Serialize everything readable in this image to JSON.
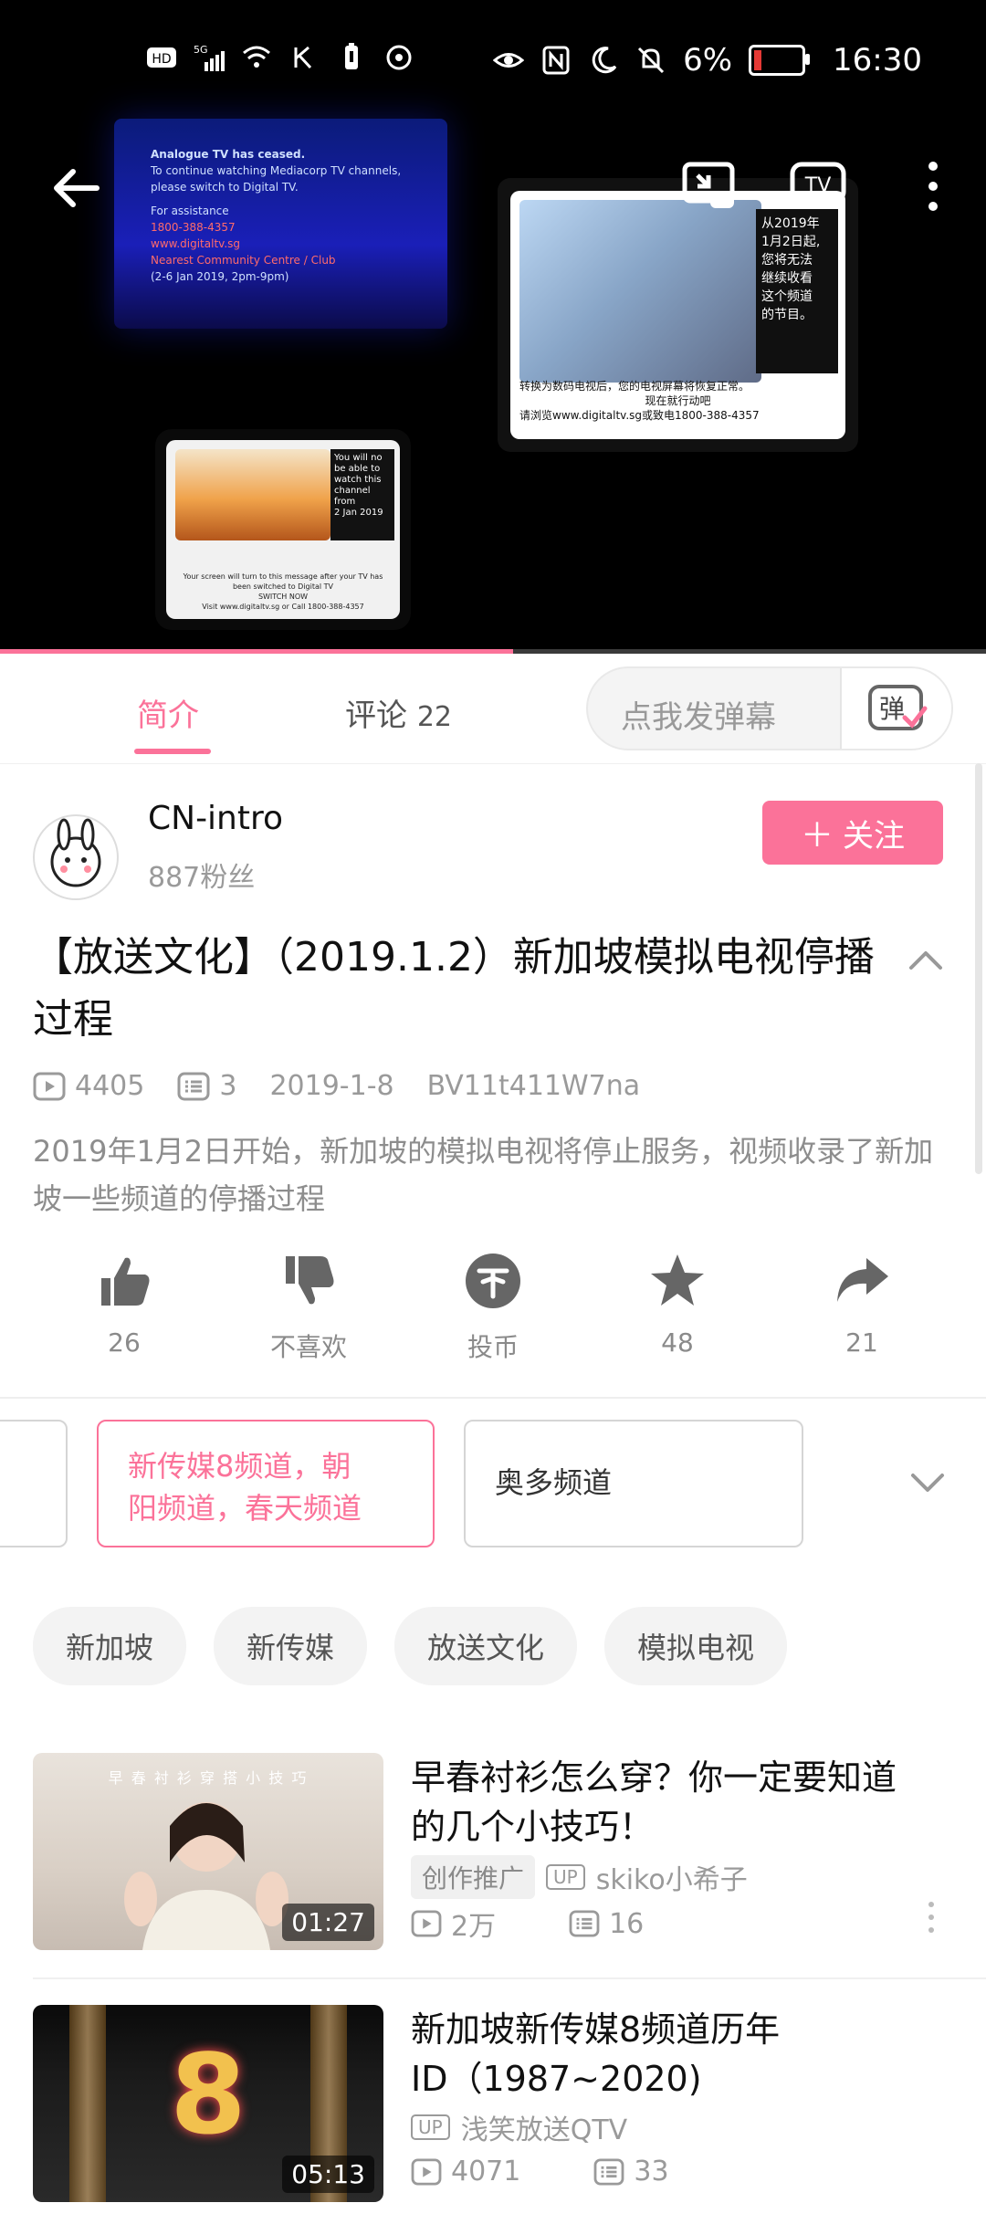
{
  "status_bar": {
    "left_icons": [
      "hd-icon",
      "signal-5g-icon",
      "wifi-icon",
      "k-icon",
      "battery-saver-icon",
      "hotspot-icon"
    ],
    "right_icons": [
      "eye-icon",
      "nfc-icon",
      "moon-icon",
      "mute-icon"
    ],
    "battery_percent": "6%",
    "time": "16:30"
  },
  "video": {
    "progress": 0.52,
    "tv_blue_text": [
      "Analogue TV has ceased.",
      "To continue watching Mediacorp TV channels,",
      "please switch to Digital TV.",
      "For assistance",
      "1800-388-4357",
      "www.digitaltv.sg",
      "Nearest Community Centre / Club",
      "(2-6 Jan 2019, 2pm-9pm)"
    ],
    "tv_left_side": [
      "You will no",
      "be able to",
      "watch this",
      "channel",
      "from",
      "2 Jan 2019"
    ],
    "tv_left_bottom": [
      "Your screen will turn to this message after your TV has been switched to Digital TV",
      "SWITCH NOW",
      "Visit www.digitaltv.sg or Call 1800-388-4357"
    ],
    "tv_right_side": [
      "从2019年",
      "1月2日起,",
      "您将无法",
      "继续收看",
      "这个频道",
      "的节目。"
    ],
    "tv_right_bottom": [
      "转换为数码电视后，您的电视屏幕将恢复正常。",
      "现在就行动吧",
      "请浏览www.digitaltv.sg或致电1800-388-4357"
    ]
  },
  "tabs": {
    "intro": "简介",
    "comments": "评论",
    "comments_count": "22",
    "danmaku_placeholder": "点我发弹幕",
    "danmaku_toggle": "弹"
  },
  "author": {
    "name": "CN-intro",
    "fans": "887粉丝",
    "follow_label": "关注",
    "follow_plus": "＋"
  },
  "video_info": {
    "title": "【放送文化】（2019.1.2）新加坡模拟电视停播过程",
    "views": "4405",
    "danmaku": "3",
    "date": "2019-1-8",
    "bvid": "BV11t411W7na",
    "description": "2019年1月2日开始，新加坡的模拟电视将停止服务，视频收录了新加坡一些频道的停播过程"
  },
  "actions": [
    {
      "name": "like",
      "label": "26"
    },
    {
      "name": "dislike",
      "label": "不喜欢"
    },
    {
      "name": "coin",
      "label": "投币"
    },
    {
      "name": "favorite",
      "label": "48"
    },
    {
      "name": "share",
      "label": "21"
    }
  ],
  "episodes": [
    {
      "label": "新传媒8频道，朝阳频道，春天频道",
      "line1": "新传媒8频道，朝",
      "line2": "阳频道，春天频道",
      "active": true
    },
    {
      "label": "奥多频道",
      "active": false
    }
  ],
  "tags": [
    "新加坡",
    "新传媒",
    "放送文化",
    "模拟电视"
  ],
  "related": [
    {
      "title": "早春衬衫怎么穿？你一定要知道的几个小技巧！",
      "title_line1": "早春衬衫怎么穿？你一定要知道",
      "title_line2": "的几个小技巧！",
      "promo": "创作推广",
      "up_badge": "UP",
      "uploader": "skiko小希子",
      "views": "2万",
      "danmaku": "16",
      "duration": "01:27",
      "thumb_caption": "早 春 衬 衫 穿 搭 小 技 巧"
    },
    {
      "title": "新加坡新传媒8频道历年ID（1987~2020)",
      "title_line1": "新加坡新传媒8频道历年",
      "title_line2": "ID（1987~2020)",
      "up_badge": "UP",
      "uploader": "浅笑放送QTV",
      "views": "4071",
      "danmaku": "33",
      "duration": "05:13",
      "thumb_caption": "8"
    }
  ],
  "colors": {
    "accent": "#fb7299",
    "muted": "#9a9a9a",
    "progress_bg": "#3a3a3a"
  }
}
